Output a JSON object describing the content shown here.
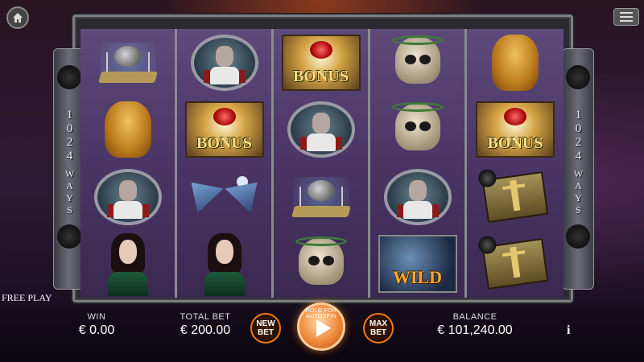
{
  "free_play_label": "FREE PLAY",
  "side_panel": {
    "ways_number": "1024",
    "ways_word": "WAYS"
  },
  "reels": [
    [
      "spider",
      "gargoyle",
      "zombie-portrait",
      "woman"
    ],
    [
      "zombie-portrait",
      "bonus",
      "bat",
      "woman"
    ],
    [
      "bonus",
      "zombie-portrait",
      "spider",
      "skull"
    ],
    [
      "skull",
      "skull",
      "zombie-portrait",
      "wild"
    ],
    [
      "gargoyle",
      "bonus",
      "book",
      "book"
    ]
  ],
  "symbols": {
    "bonus_label": "BONUS",
    "wild_label": "WILD"
  },
  "bottom_bar": {
    "win_label": "WIN",
    "win_value": "€ 0.00",
    "total_bet_label": "TOTAL BET",
    "total_bet_value": "€ 200.00",
    "new_bet_label": "NEW BET",
    "spin_hint": "HOLD FOR AUTOSPIN",
    "max_bet_label": "MAX BET",
    "balance_label": "BALANCE",
    "balance_value": "€ 101,240.00",
    "info_label": "i"
  },
  "colors": {
    "accent": "#f07a1a",
    "frame": "#7d7d85"
  }
}
